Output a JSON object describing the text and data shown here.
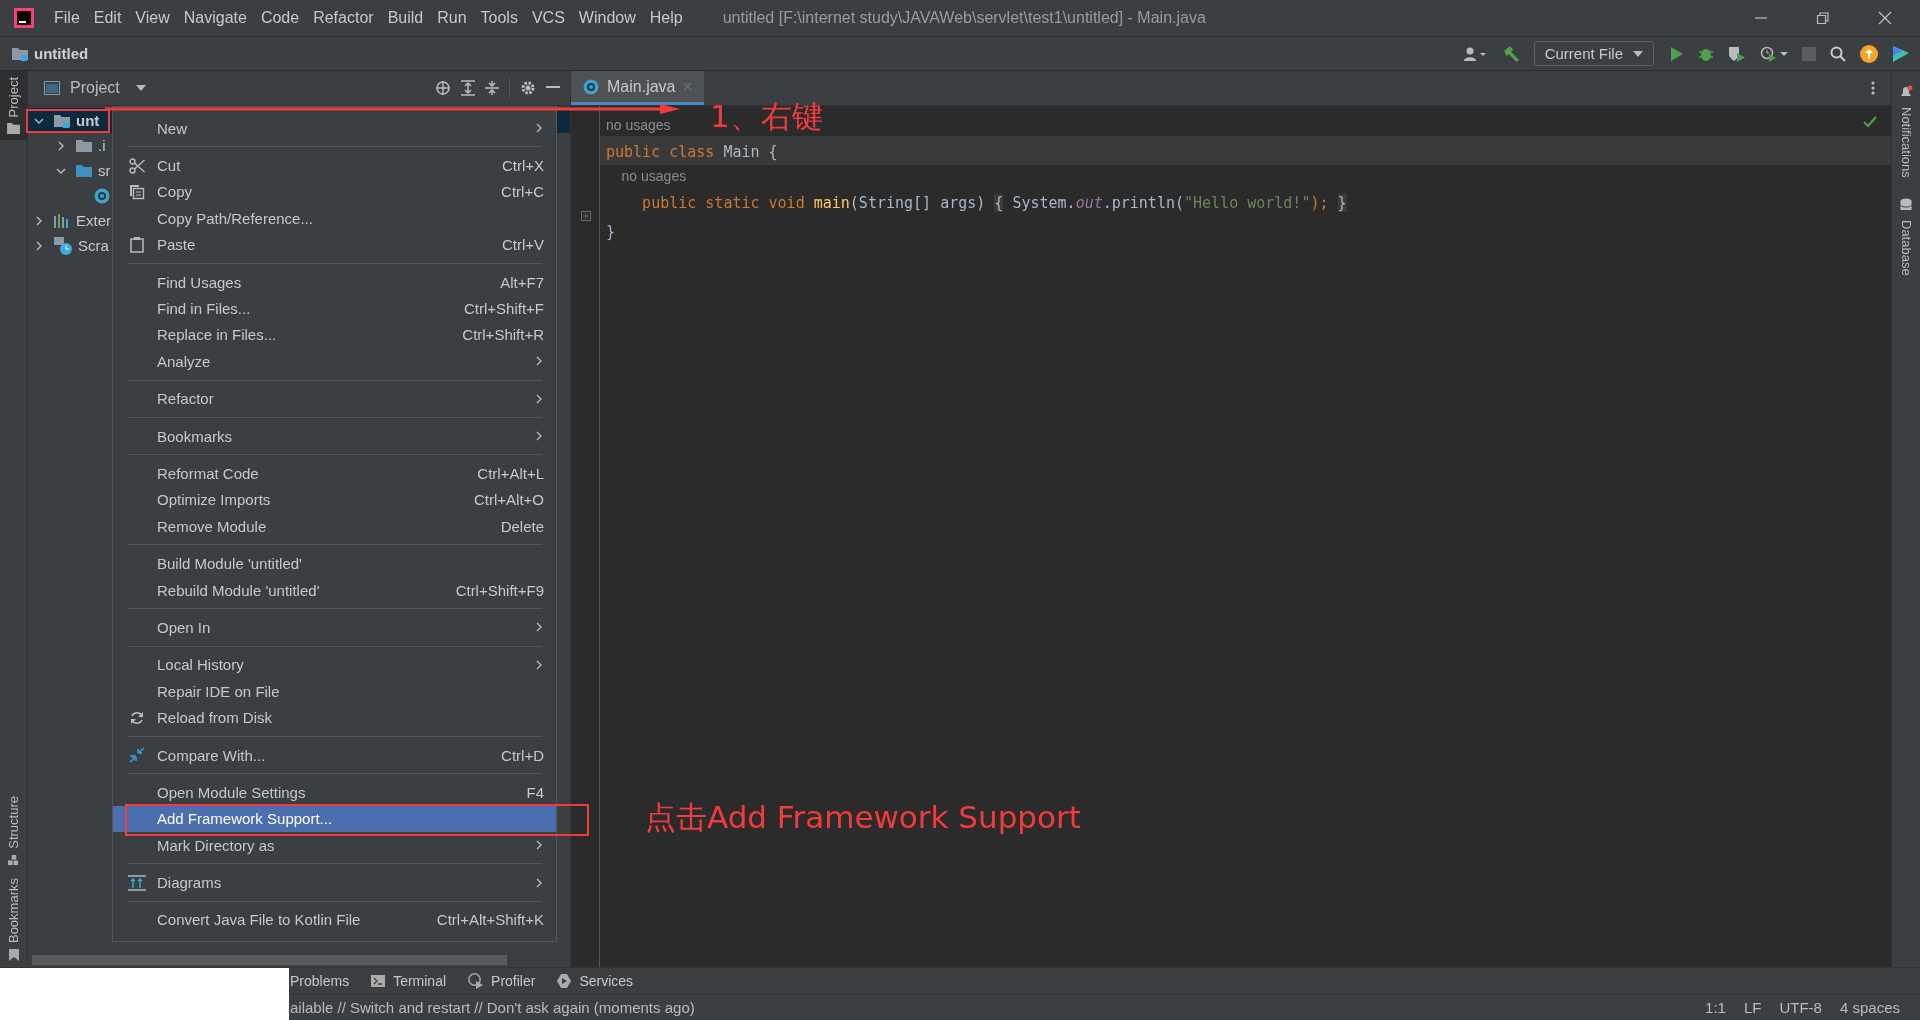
{
  "menu_bar": {
    "items": [
      "File",
      "Edit",
      "View",
      "Navigate",
      "Code",
      "Refactor",
      "Build",
      "Run",
      "Tools",
      "VCS",
      "Window",
      "Help"
    ],
    "title": "untitled [F:\\internet study\\JAVAWeb\\servlet\\test1\\untitled] - Main.java"
  },
  "nav_bar": {
    "project": "untitled",
    "run_config": "Current File"
  },
  "left_strip": {
    "top": [
      {
        "label": "Project",
        "selected": true
      }
    ],
    "bottom": [
      {
        "label": "Structure",
        "selected": false
      },
      {
        "label": "Bookmarks",
        "selected": false
      }
    ]
  },
  "project_panel": {
    "title": "Project",
    "tree": [
      {
        "label": "unt",
        "kind": "module",
        "expanded": true,
        "selected": true,
        "children": [
          {
            "label": ".i",
            "kind": "folder",
            "expanded": false
          },
          {
            "label": "sr",
            "kind": "source",
            "expanded": true,
            "children": [
              {
                "kind": "class"
              }
            ]
          }
        ]
      },
      {
        "label": "Exter",
        "kind": "library",
        "expanded": false
      },
      {
        "label": "Scra",
        "kind": "scratch",
        "expanded": false
      }
    ]
  },
  "editor": {
    "tab": {
      "label": "Main.java",
      "selected": true
    },
    "lines": [
      {
        "kind": "hint",
        "tokens": [
          {
            "text": "no usages",
            "kind": "hint"
          }
        ]
      },
      {
        "kind": "code",
        "current": true,
        "tokens": [
          {
            "text": "public class ",
            "kind": "keyword"
          },
          {
            "text": "Main {",
            "kind": "plain"
          }
        ]
      },
      {
        "kind": "hint",
        "tokens": [
          {
            "text": "    no usages",
            "kind": "hint"
          }
        ]
      },
      {
        "kind": "code",
        "current": false,
        "tokens": [
          {
            "text": "    public static void ",
            "kind": "keyword"
          },
          {
            "text": "main",
            "kind": "method"
          },
          {
            "text": "(String[] args) ",
            "kind": "plain"
          },
          {
            "text": "{",
            "kind": "fold"
          },
          {
            "text": " System.",
            "kind": "plain"
          },
          {
            "text": "out",
            "kind": "static"
          },
          {
            "text": ".println(",
            "kind": "plain"
          },
          {
            "text": "\"Hello world!\"",
            "kind": "string"
          },
          {
            "text": "); ",
            "kind": "keyword"
          },
          {
            "text": "}",
            "kind": "fold"
          }
        ]
      },
      {
        "kind": "code",
        "current": false,
        "tokens": [
          {
            "text": "}",
            "kind": "plain"
          }
        ]
      }
    ]
  },
  "context_menu": {
    "items": [
      {
        "kind": "item",
        "label": "New",
        "submenu": true,
        "selected": false
      },
      {
        "kind": "separator"
      },
      {
        "kind": "item",
        "label": "Cut",
        "shortcut": "Ctrl+X",
        "selected": false
      },
      {
        "kind": "item",
        "label": "Copy",
        "shortcut": "Ctrl+C",
        "selected": false
      },
      {
        "kind": "item",
        "label": "Copy Path/Reference...",
        "selected": false
      },
      {
        "kind": "item",
        "label": "Paste",
        "shortcut": "Ctrl+V",
        "selected": false
      },
      {
        "kind": "separator"
      },
      {
        "kind": "item",
        "label": "Find Usages",
        "shortcut": "Alt+F7",
        "selected": false
      },
      {
        "kind": "item",
        "label": "Find in Files...",
        "shortcut": "Ctrl+Shift+F",
        "selected": false
      },
      {
        "kind": "item",
        "label": "Replace in Files...",
        "shortcut": "Ctrl+Shift+R",
        "selected": false
      },
      {
        "kind": "item",
        "label": "Analyze",
        "submenu": true,
        "selected": false
      },
      {
        "kind": "separator"
      },
      {
        "kind": "item",
        "label": "Refactor",
        "submenu": true,
        "selected": false
      },
      {
        "kind": "separator"
      },
      {
        "kind": "item",
        "label": "Bookmarks",
        "submenu": true,
        "selected": false
      },
      {
        "kind": "separator"
      },
      {
        "kind": "item",
        "label": "Reformat Code",
        "shortcut": "Ctrl+Alt+L",
        "selected": false
      },
      {
        "kind": "item",
        "label": "Optimize Imports",
        "shortcut": "Ctrl+Alt+O",
        "selected": false
      },
      {
        "kind": "item",
        "label": "Remove Module",
        "shortcut": "Delete",
        "selected": false
      },
      {
        "kind": "separator"
      },
      {
        "kind": "item",
        "label": "Build Module 'untitled'",
        "selected": false
      },
      {
        "kind": "item",
        "label": "Rebuild Module 'untitled'",
        "shortcut": "Ctrl+Shift+F9",
        "selected": false
      },
      {
        "kind": "separator"
      },
      {
        "kind": "item",
        "label": "Open In",
        "submenu": true,
        "selected": false
      },
      {
        "kind": "separator"
      },
      {
        "kind": "item",
        "label": "Local History",
        "submenu": true,
        "selected": false
      },
      {
        "kind": "item",
        "label": "Repair IDE on File",
        "selected": false
      },
      {
        "kind": "item",
        "label": "Reload from Disk",
        "selected": false
      },
      {
        "kind": "separator"
      },
      {
        "kind": "item",
        "label": "Compare With...",
        "shortcut": "Ctrl+D",
        "selected": false
      },
      {
        "kind": "separator"
      },
      {
        "kind": "item",
        "label": "Open Module Settings",
        "shortcut": "F4",
        "selected": false
      },
      {
        "kind": "item",
        "label": "Add Framework Support...",
        "selected": true
      },
      {
        "kind": "item",
        "label": "Mark Directory as",
        "submenu": true,
        "selected": false
      },
      {
        "kind": "separator"
      },
      {
        "kind": "item",
        "label": "Diagrams",
        "submenu": true,
        "selected": false
      },
      {
        "kind": "separator"
      },
      {
        "kind": "item",
        "label": "Convert Java File to Kotlin File",
        "shortcut": "Ctrl+Alt+Shift+K",
        "selected": false
      }
    ]
  },
  "right_strip": [
    "Notifications",
    "Database"
  ],
  "bottom_tools": [
    "Problems",
    "Terminal",
    "Profiler",
    "Services"
  ],
  "status_bar": {
    "message": "ailable // Switch and restart // Don't ask again (moments ago)",
    "items": [
      "1:1",
      "LF",
      "UTF-8",
      "4 spaces"
    ]
  },
  "annotations": [
    {
      "kind": "box"
    },
    {
      "kind": "arrow"
    },
    {
      "kind": "note",
      "text": "1、右键"
    },
    {
      "kind": "box"
    },
    {
      "kind": "note",
      "text": "点击Add Framework Support"
    }
  ]
}
